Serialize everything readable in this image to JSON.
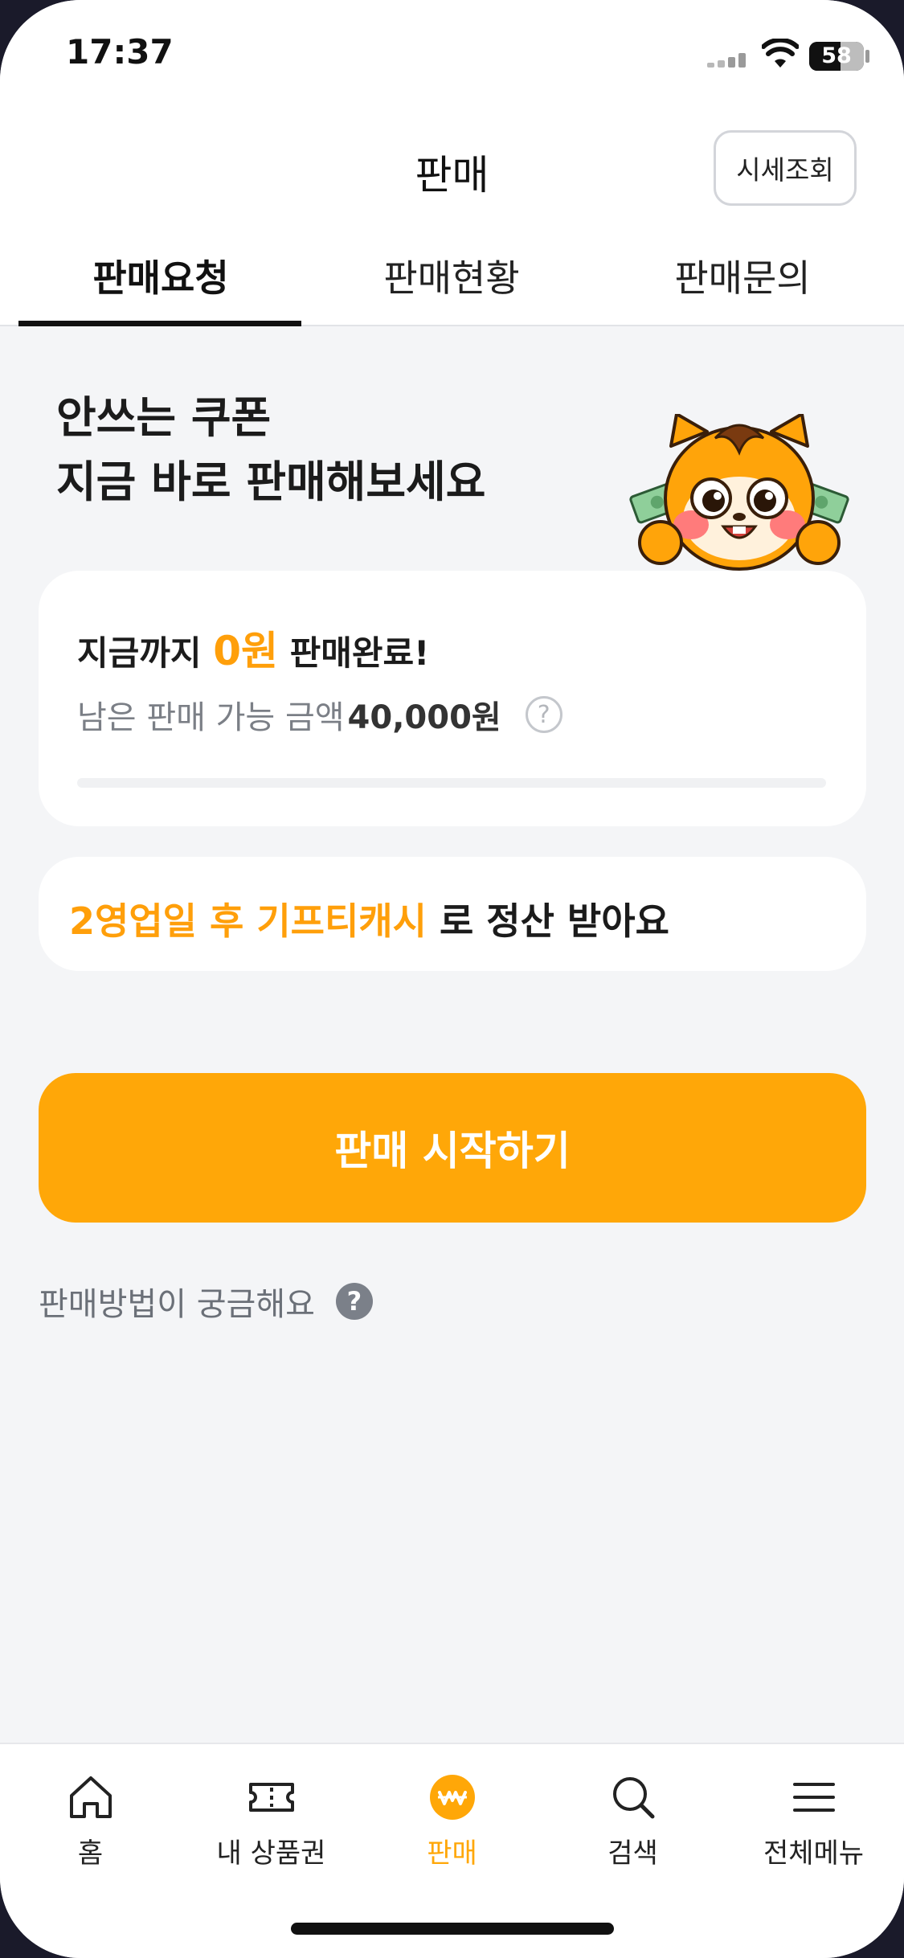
{
  "status_bar": {
    "time": "17:37",
    "battery": "58"
  },
  "header": {
    "title": "판매",
    "price_lookup_label": "시세조회"
  },
  "tabs": [
    {
      "label": "판매요청",
      "active": true
    },
    {
      "label": "판매현황",
      "active": false
    },
    {
      "label": "판매문의",
      "active": false
    }
  ],
  "hero": {
    "line1": "안쓰는 쿠폰",
    "line2": "지금 바로 판매해보세요"
  },
  "sales_card": {
    "prefix": "지금까지",
    "amount": "0원",
    "suffix": "판매완료!",
    "remain_label": "남은 판매 가능 금액",
    "remain_amount": "40,000원",
    "help_glyph": "?",
    "progress": 0
  },
  "settle_card": {
    "accent": "2영업일 후 기프티캐시",
    "rest": "로 정산 받아요"
  },
  "start_button_label": "판매 시작하기",
  "how_to_label": "판매방법이 궁금해요",
  "how_to_glyph": "?",
  "bottom_nav": [
    {
      "label": "홈",
      "icon": "home-icon"
    },
    {
      "label": "내 상품권",
      "icon": "ticket-icon"
    },
    {
      "label": "판매",
      "icon": "won-coin-icon",
      "active": true
    },
    {
      "label": "검색",
      "icon": "search-icon"
    },
    {
      "label": "전체메뉴",
      "icon": "menu-icon"
    }
  ],
  "colors": {
    "accent": "#ffa708",
    "background": "#f4f5f7",
    "text": "#1b1b1b"
  }
}
